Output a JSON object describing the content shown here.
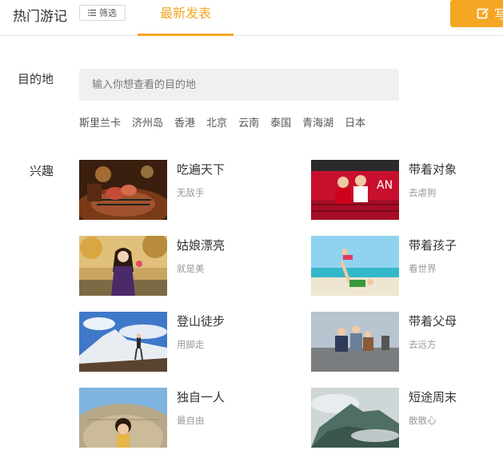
{
  "header": {
    "title": "热门游记",
    "filter_label": "筛选",
    "tab_latest": "最新发表",
    "write_label": "写"
  },
  "destination": {
    "label": "目的地",
    "placeholder": "输入你想查看的目的地",
    "tags": [
      "斯里兰卡",
      "济州岛",
      "香港",
      "北京",
      "云南",
      "泰国",
      "青海湖",
      "日本"
    ]
  },
  "interest": {
    "label": "兴趣",
    "cards": [
      {
        "title": "吃遍天下",
        "subtitle": "无敌手"
      },
      {
        "title": "带着对象",
        "subtitle": "去虐狗"
      },
      {
        "title": "姑娘漂亮",
        "subtitle": "就是美"
      },
      {
        "title": "带着孩子",
        "subtitle": "看世界"
      },
      {
        "title": "登山徒步",
        "subtitle": "用脚走"
      },
      {
        "title": "带着父母",
        "subtitle": "去远方"
      },
      {
        "title": "独自一人",
        "subtitle": "最自由"
      },
      {
        "title": "短途周末",
        "subtitle": "散散心"
      }
    ]
  },
  "colors": {
    "accent": "#f5a623",
    "text": "#333333",
    "muted": "#999999",
    "input_bg": "#f0f0f0"
  }
}
